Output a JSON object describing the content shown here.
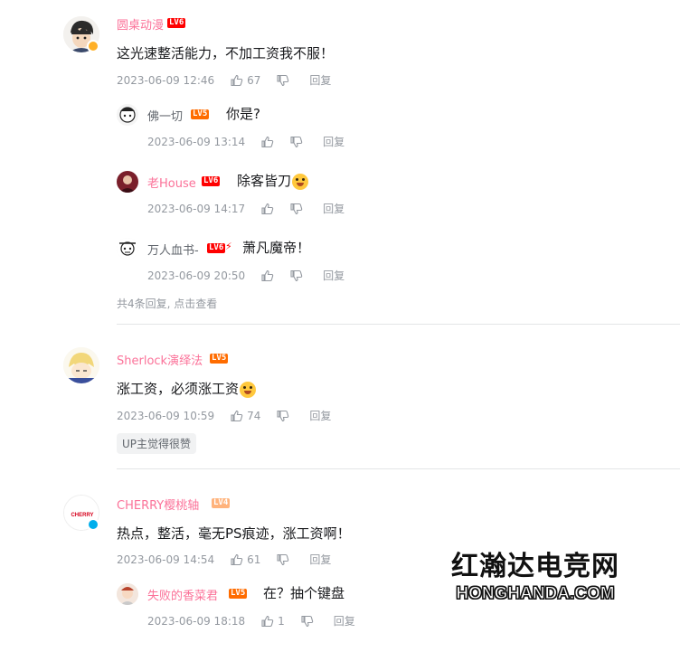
{
  "comments": [
    {
      "user": "圆桌动漫",
      "level": "LV6",
      "text": "这光速整活能力，不加工资我不服！",
      "time": "2023-06-09 12:46",
      "likes": "67",
      "reply_label": "回复",
      "replies": [
        {
          "user": "佛一切",
          "level": "LV5",
          "text": "你是?",
          "time": "2023-06-09 13:14",
          "likes": "",
          "reply_label": "回复"
        },
        {
          "user": "老House",
          "level": "LV6",
          "text": "除客皆刀",
          "time": "2023-06-09 14:17",
          "likes": "",
          "reply_label": "回复"
        },
        {
          "user": "万人血书-",
          "level": "LV6",
          "text": "萧凡魔帝！",
          "time": "2023-06-09 20:50",
          "likes": "",
          "reply_label": "回复"
        }
      ],
      "more_replies": "共4条回复, 点击查看"
    },
    {
      "user": "Sherlock演绎法",
      "level": "LV5",
      "text": "涨工资，必须涨工资",
      "time": "2023-06-09 10:59",
      "likes": "74",
      "reply_label": "回复",
      "up_tag": "UP主觉得很赞"
    },
    {
      "user": "CHERRY樱桃轴",
      "level": "LV4",
      "text": "热点，整活，毫无PS痕迹，涨工资啊！",
      "time": "2023-06-09 14:54",
      "likes": "61",
      "reply_label": "回复",
      "replies": [
        {
          "user": "失败的香菜君",
          "level": "LV5",
          "text": "在？抽个键盘",
          "time": "2023-06-09 18:18",
          "likes": "1",
          "reply_label": "回复"
        }
      ]
    }
  ],
  "watermark": {
    "cn": "红瀚达电竞网",
    "en": "HONGHANDA.COM"
  },
  "colors": {
    "username_pink": "#fb7299",
    "meta_gray": "#9499a0",
    "lv6": "#ff0000",
    "lv5": "#ff6c00",
    "lv4": "#ffb37c",
    "vip_badge": "#ffb027",
    "blue_badge": "#00aeec"
  }
}
